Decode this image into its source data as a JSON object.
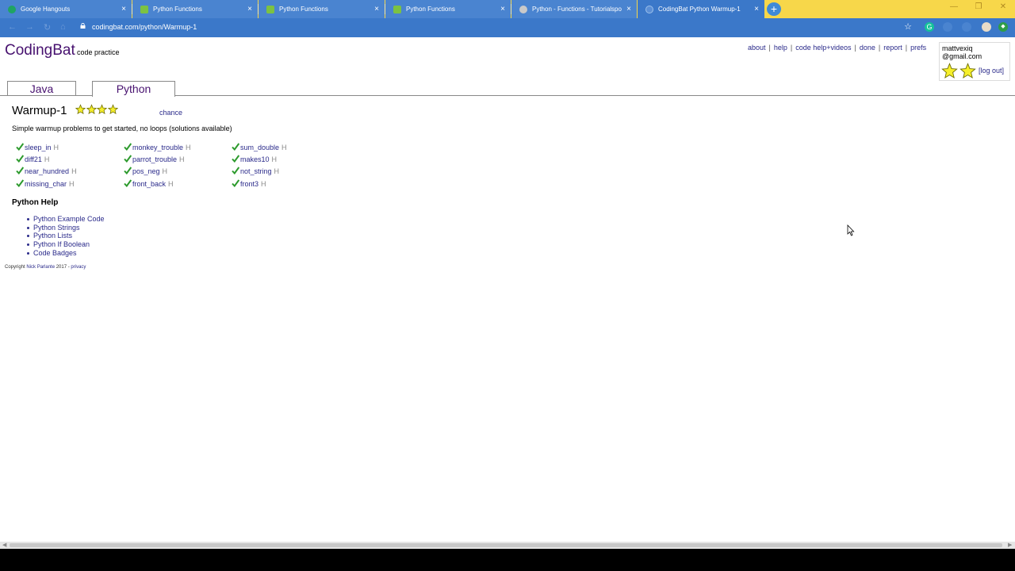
{
  "browser": {
    "tabs": [
      {
        "title": "Google Hangouts",
        "favicon_color": "#1fa463"
      },
      {
        "title": "Python Functions",
        "favicon_color": "#7cc242"
      },
      {
        "title": "Python Functions",
        "favicon_color": "#7cc242"
      },
      {
        "title": "Python Functions",
        "favicon_color": "#7cc242"
      },
      {
        "title": "Python - Functions - Tutorialspo",
        "favicon_color": "#c9c9c9"
      },
      {
        "title": "CodingBat Python Warmup-1",
        "favicon_color": "#3b78c9"
      }
    ],
    "tab_close_glyph": "×",
    "new_tab_glyph": "+",
    "url": "codingbat.com/python/Warmup-1",
    "chrome_color": "#3b78c9",
    "tabstrip_color": "#f7d74a"
  },
  "header": {
    "logo": "CodingBat",
    "tagline": "code practice",
    "links": [
      "about",
      "help",
      "code help+videos",
      "done",
      "report",
      "prefs"
    ],
    "link_separator": "|"
  },
  "user": {
    "email_line1": "mattvexiq",
    "email_line2": "@gmail.com",
    "logout": "[log out]"
  },
  "lang_tabs": {
    "java": "Java",
    "python": "Python"
  },
  "section": {
    "title": "Warmup-1",
    "star_count": 4,
    "chance": "chance",
    "description": "Simple warmup problems to get started, no loops (solutions available)"
  },
  "problems": {
    "hint_marker": "H",
    "columns": [
      [
        "sleep_in",
        "diff21",
        "near_hundred",
        "missing_char"
      ],
      [
        "monkey_trouble",
        "parrot_trouble",
        "pos_neg",
        "front_back"
      ],
      [
        "sum_double",
        "makes10",
        "not_string",
        "front3"
      ]
    ]
  },
  "help": {
    "title": "Python Help",
    "links": [
      "Python Example Code",
      "Python Strings",
      "Python Lists",
      "Python If Boolean",
      "Code Badges"
    ]
  },
  "footer": {
    "prefix": "Copyright ",
    "author": "Nick Parlante",
    "middle": " 2017 - ",
    "privacy": "privacy"
  },
  "colors": {
    "logo": "#47116f",
    "link": "#2a2a8a",
    "check": "#2c9a2c",
    "star_fill": "#f6ef2b"
  }
}
